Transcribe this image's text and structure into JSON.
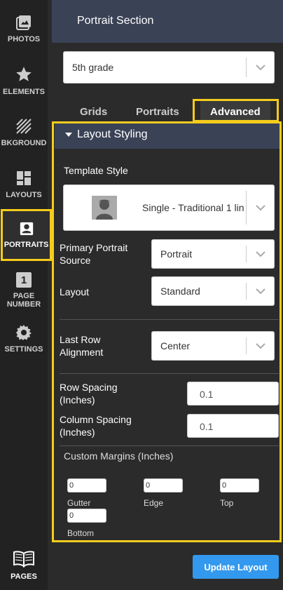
{
  "sidebar": {
    "items": [
      {
        "label": "PHOTOS"
      },
      {
        "label": "ELEMENTS"
      },
      {
        "label": "BKGROUND"
      },
      {
        "label": "LAYOUTS"
      },
      {
        "label": "PORTRAITS"
      },
      {
        "label_line1": "PAGE",
        "label_line2": "NUMBER",
        "badge": "1"
      },
      {
        "label": "SETTINGS"
      },
      {
        "label": "PAGES"
      }
    ]
  },
  "header": {
    "title": "Portrait Section"
  },
  "grade_select": {
    "value": "5th grade"
  },
  "tabs": [
    {
      "label": "Grids"
    },
    {
      "label": "Portraits"
    },
    {
      "label": "Advanced"
    }
  ],
  "section": {
    "title": "Layout Styling"
  },
  "template_style": {
    "label": "Template Style",
    "value": "Single - Traditional 1 lin"
  },
  "primary_source": {
    "label_line1": "Primary Portrait",
    "label_line2": "Source",
    "value": "Portrait"
  },
  "layout": {
    "label": "Layout",
    "value": "Standard"
  },
  "last_row": {
    "label_line1": "Last Row",
    "label_line2": "Alignment",
    "value": "Center"
  },
  "row_spacing": {
    "label_line1": "Row Spacing",
    "label_line2": "(Inches)",
    "value": "0.1"
  },
  "column_spacing": {
    "label_line1": "Column Spacing",
    "label_line2": "(Inches)",
    "value": "0.1"
  },
  "margins": {
    "title": "Custom Margins (Inches)",
    "gutter": {
      "label": "Gutter",
      "value": "0"
    },
    "edge": {
      "label": "Edge",
      "value": "0"
    },
    "top": {
      "label": "Top",
      "value": "0"
    },
    "bottom": {
      "label": "Bottom",
      "value": "0"
    }
  },
  "update_button": {
    "label": "Update Layout"
  },
  "colors": {
    "accent": "#f5cc1c",
    "header": "#3a4256",
    "button": "#3399ee"
  }
}
